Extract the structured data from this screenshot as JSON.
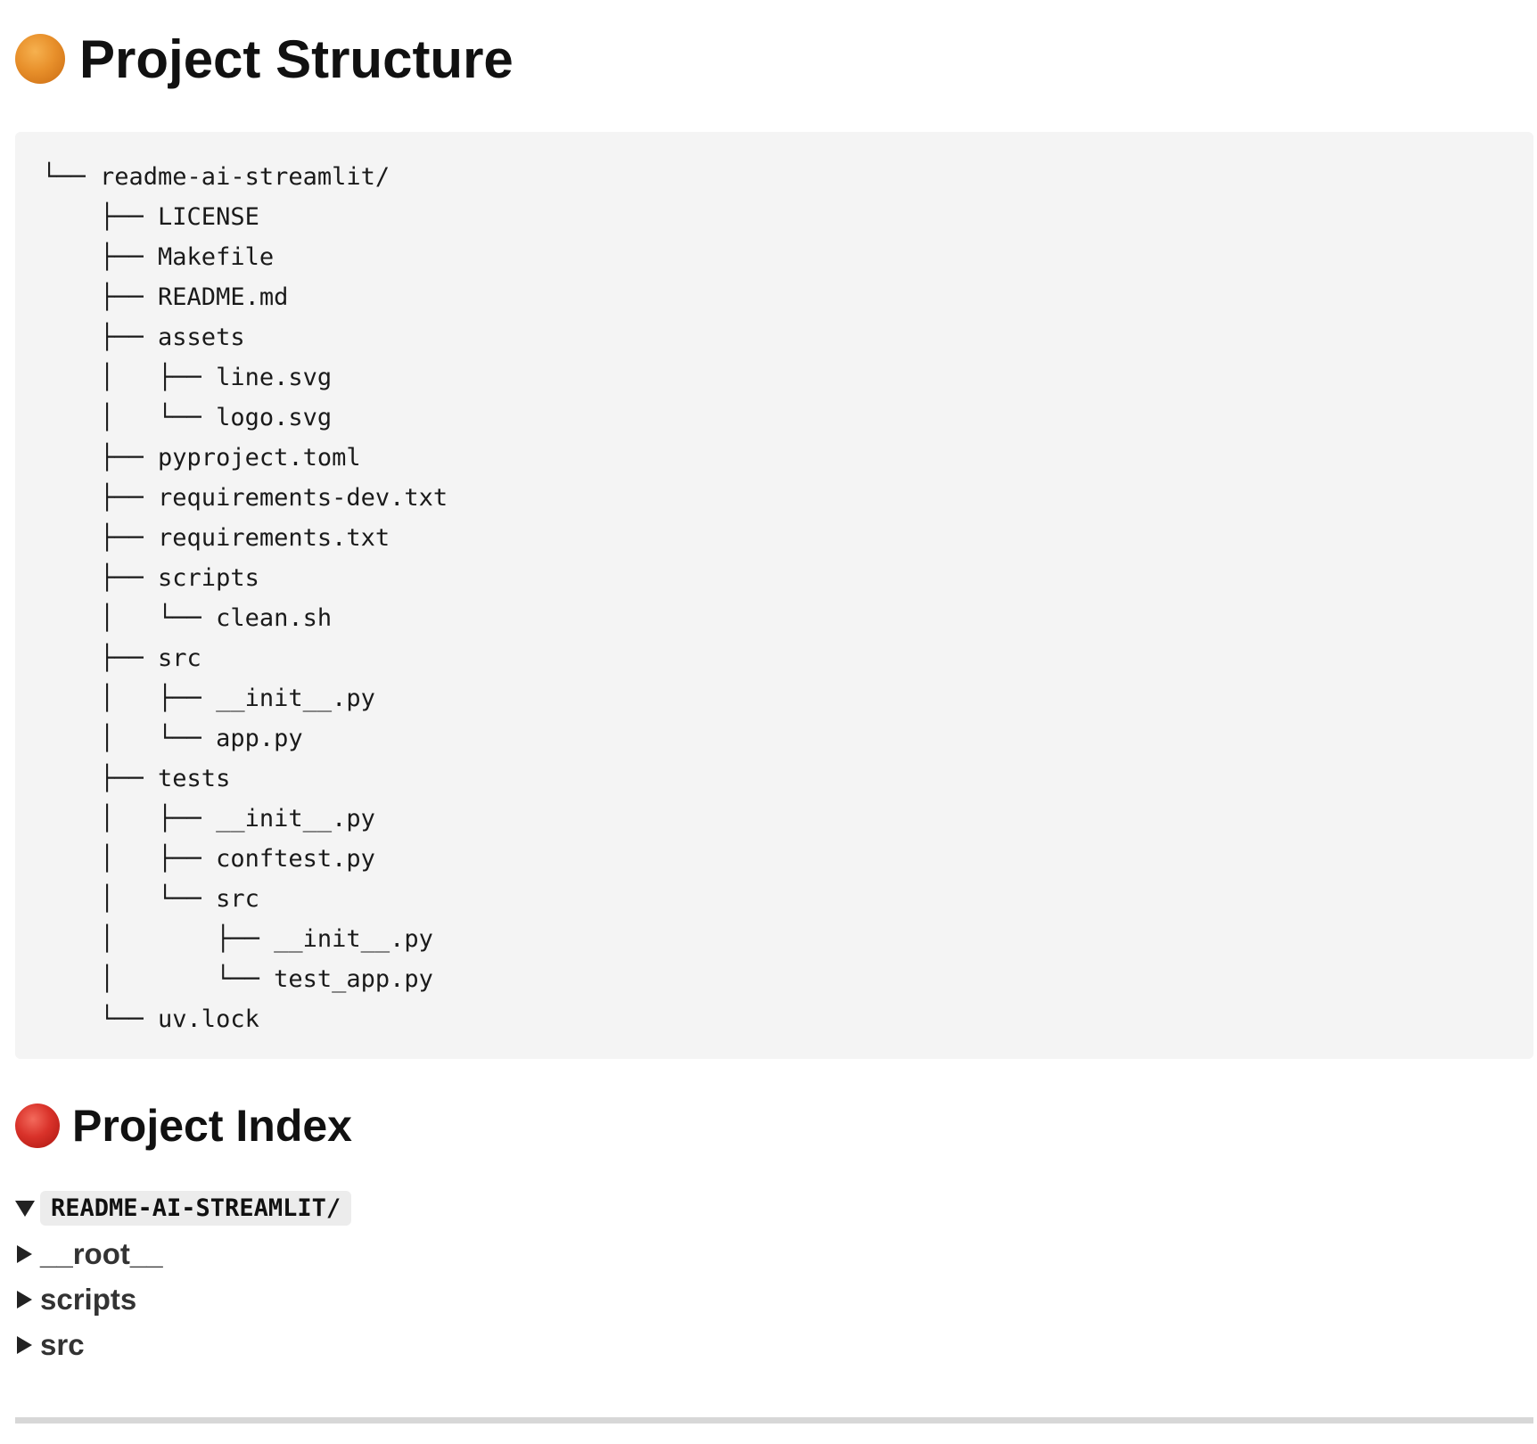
{
  "structure": {
    "title": "Project Structure",
    "dot_color": "#e8902b",
    "tree": [
      "└── readme-ai-streamlit/",
      "    ├── LICENSE",
      "    ├── Makefile",
      "    ├── README.md",
      "    ├── assets",
      "    │   ├── line.svg",
      "    │   └── logo.svg",
      "    ├── pyproject.toml",
      "    ├── requirements-dev.txt",
      "    ├── requirements.txt",
      "    ├── scripts",
      "    │   └── clean.sh",
      "    ├── src",
      "    │   ├── __init__.py",
      "    │   └── app.py",
      "    ├── tests",
      "    │   ├── __init__.py",
      "    │   ├── conftest.py",
      "    │   └── src",
      "    │       ├── __init__.py",
      "    │       └── test_app.py",
      "    └── uv.lock"
    ]
  },
  "index": {
    "title": "Project Index",
    "dot_color": "#d9322a",
    "root_label": "README-AI-STREAMLIT/",
    "items": [
      {
        "label": "__root__",
        "expanded": false
      },
      {
        "label": "scripts",
        "expanded": false
      },
      {
        "label": "src",
        "expanded": false
      }
    ]
  }
}
